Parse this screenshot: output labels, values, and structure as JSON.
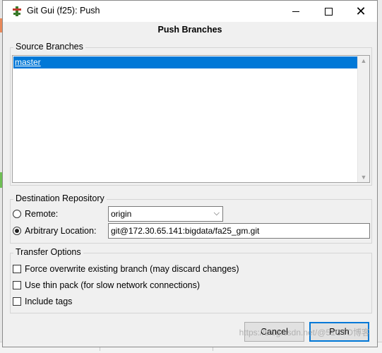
{
  "window": {
    "title": "Git Gui (f25): Push",
    "controls": {
      "minimize": "minimize-icon",
      "maximize": "maximize-icon",
      "close": "close-icon"
    }
  },
  "dialog": {
    "heading": "Push Branches"
  },
  "source": {
    "legend": "Source Branches",
    "branches": [
      {
        "label": "master",
        "selected": true
      }
    ]
  },
  "destination": {
    "legend": "Destination Repository",
    "remote_label": "Remote:",
    "remote_value": "origin",
    "arbitrary_label": "Arbitrary Location:",
    "arbitrary_value": "git@172.30.65.141:bigdata/fa25_gm.git",
    "selected": "arbitrary"
  },
  "transfer": {
    "legend": "Transfer Options",
    "options": [
      {
        "label": "Force overwrite existing branch (may discard changes)",
        "checked": false
      },
      {
        "label": "Use thin pack (for slow network connections)",
        "checked": false
      },
      {
        "label": "Include tags",
        "checked": false
      }
    ]
  },
  "buttons": {
    "cancel": "Cancel",
    "push": "Push"
  },
  "watermark": "https://blog.csdn.net/@51CTO博客",
  "colors": {
    "selection": "#0078d7",
    "window_bg": "#f0f0f0"
  }
}
